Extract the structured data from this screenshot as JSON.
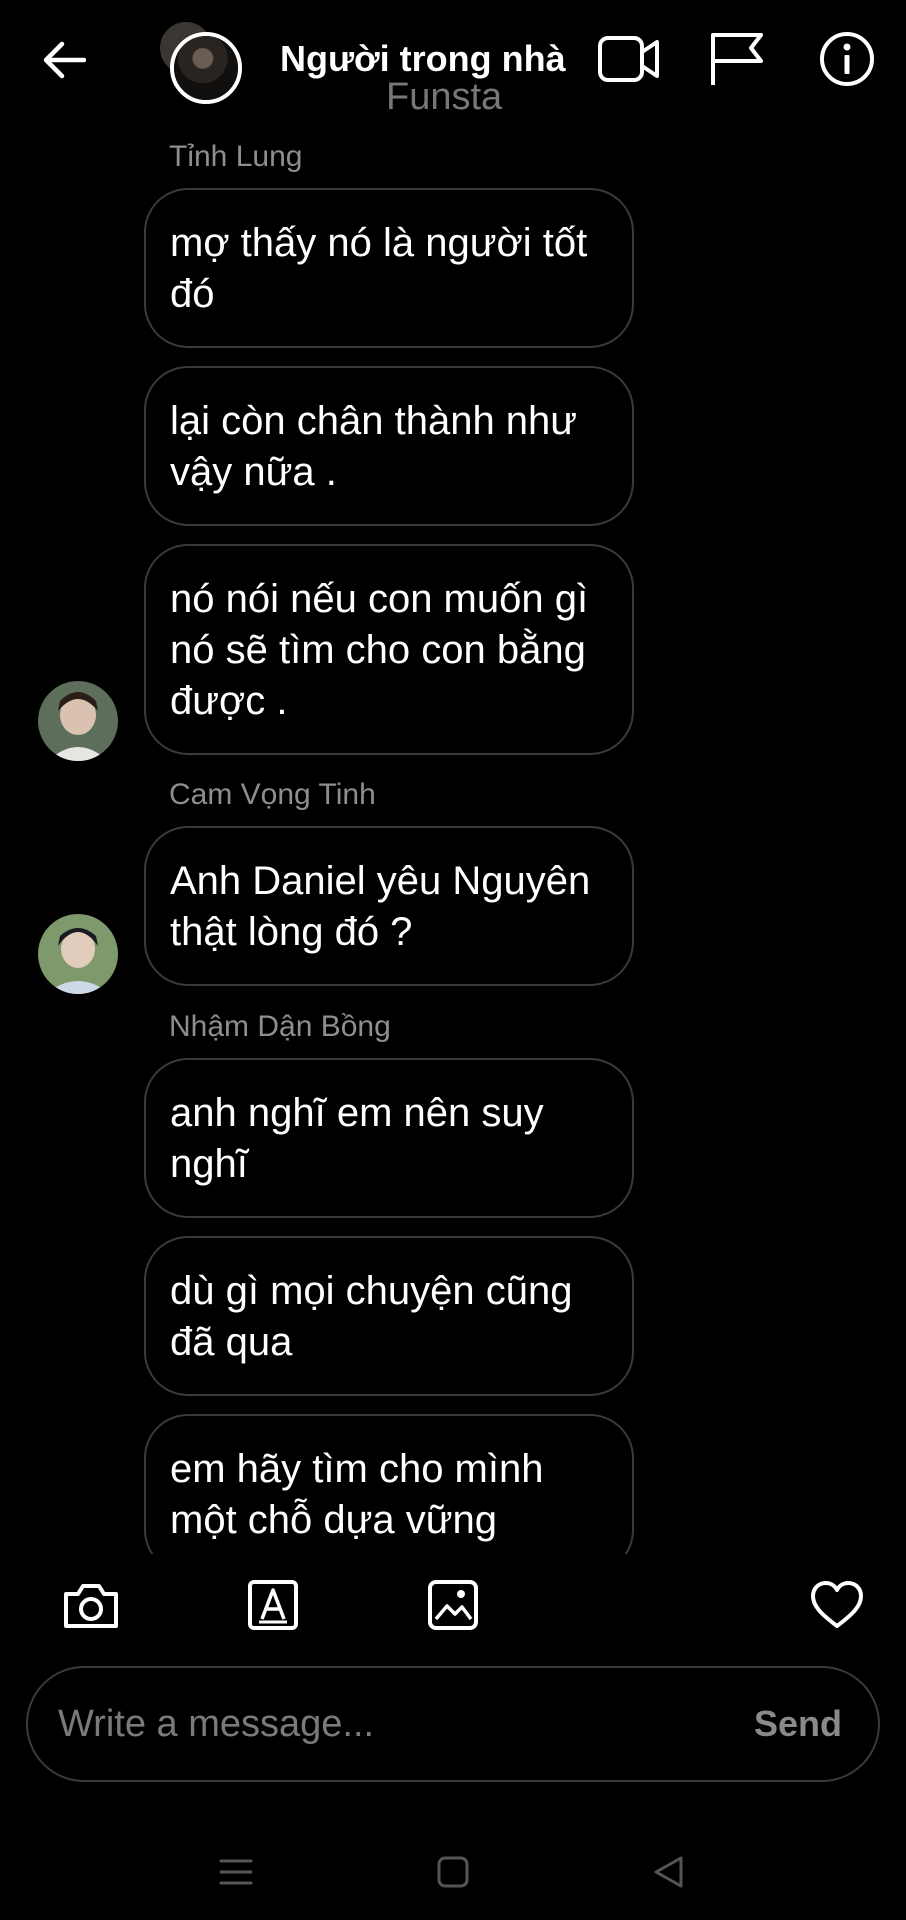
{
  "header": {
    "title": "Người trong nhà",
    "subtitle": "Funsta",
    "icons": [
      "back-arrow-icon",
      "video-call-icon",
      "flag-icon",
      "info-icon"
    ]
  },
  "messages": [
    {
      "sender": "Tỉnh Lung",
      "bubbles": [
        "mợ thấy nó là người tốt đó",
        "lại còn chân thành như vậy nữa .",
        "nó nói nếu con muốn gì nó sẽ tìm cho con bằng được ."
      ]
    },
    {
      "sender": "Cam Vọng Tinh",
      "bubbles": [
        "Anh Daniel yêu Nguyên thật lòng đó ?"
      ]
    },
    {
      "sender": "Nhậm Dận Bồng",
      "bubbles": [
        "anh nghĩ em nên suy nghĩ",
        "dù gì mọi chuyện cũng đã qua",
        "em hãy tìm cho mình một chỗ dựa vững"
      ]
    }
  ],
  "toolbar": {
    "icons": [
      "camera-icon",
      "text-style-icon",
      "gallery-icon",
      "heart-icon"
    ]
  },
  "composer": {
    "placeholder": "Write a message...",
    "send_label": "Send"
  },
  "colors": {
    "background": "#000000",
    "bubble_border": "#3a3a3a",
    "sender_text": "#8e8e8e",
    "subtitle": "#777777"
  }
}
